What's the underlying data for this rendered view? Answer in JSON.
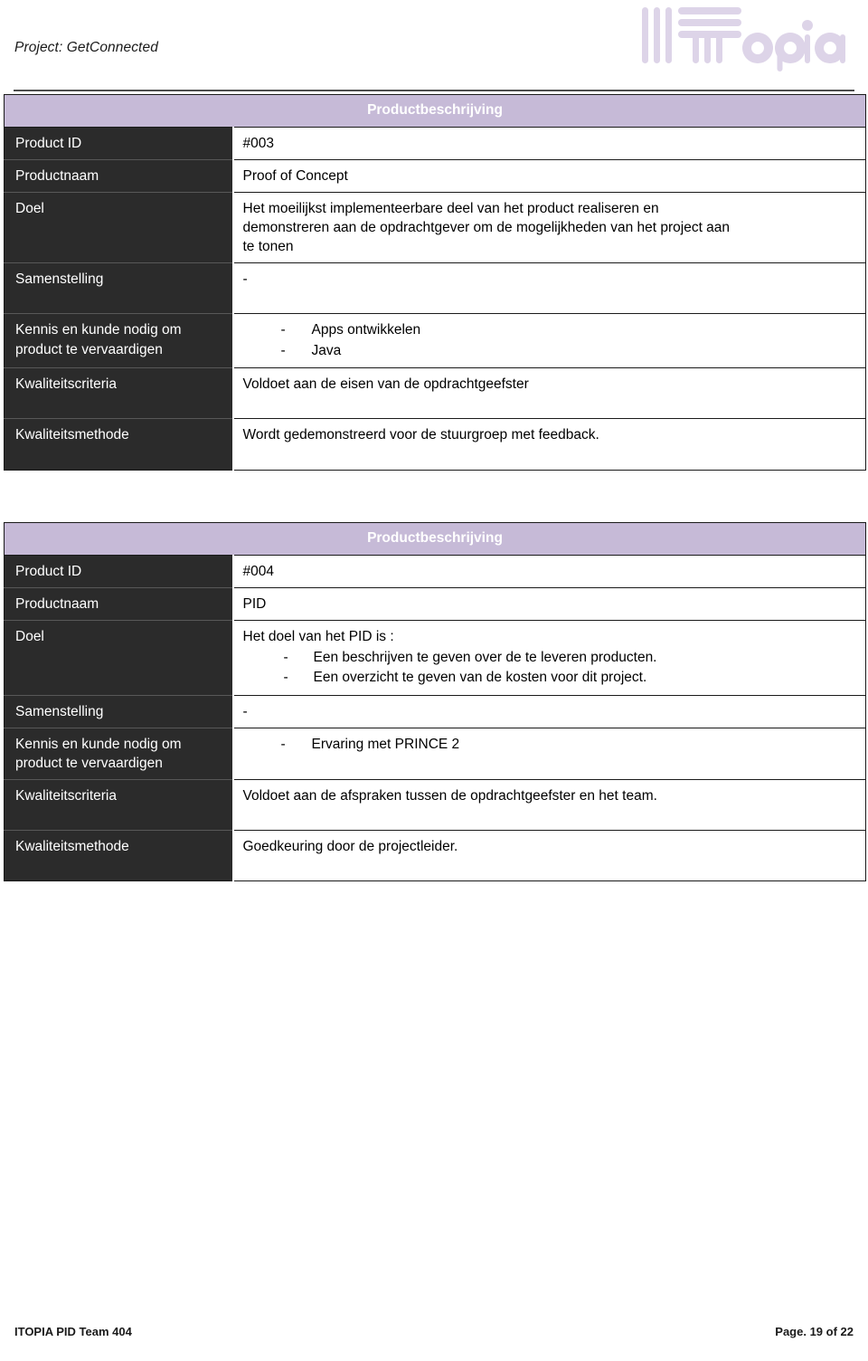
{
  "header": {
    "project_label": "Project: GetConnected",
    "logo_text": "ITOPIA",
    "logo_color": "#ddd4e8"
  },
  "theme": {
    "caption_bg": "#c6bad7",
    "label_bg": "#2b2b2b",
    "label_fg": "#ffffff",
    "value_bg": "#ffffff",
    "rule_color": "#4d4d4d"
  },
  "tables": [
    {
      "caption": "Productbeschrijving",
      "rows": [
        {
          "label": "Product ID",
          "value_lines": [
            "#003"
          ]
        },
        {
          "label": "Productnaam",
          "value_lines": [
            "Proof of Concept"
          ]
        },
        {
          "label": "Doel",
          "value_lines": [
            "Het moeilijkst implementeerbare deel van het product realiseren en",
            "demonstreren aan de opdrachtgever om de mogelijkheden van het project aan",
            "te tonen"
          ]
        },
        {
          "label": "Samenstelling",
          "value_lines": [
            "-"
          ]
        },
        {
          "label_lines": [
            "Kennis en kunde nodig om",
            "product te vervaardigen"
          ],
          "label": "Kennis en kunde nodig om product te vervaardigen",
          "bullets": [
            "Apps ontwikkelen",
            "Java"
          ]
        },
        {
          "label": "Kwaliteitscriteria",
          "value_lines": [
            "Voldoet aan de eisen van de opdrachtgeefster"
          ]
        },
        {
          "label": "Kwaliteitsmethode",
          "value_lines": [
            "Wordt gedemonstreerd voor de stuurgroep met feedback."
          ]
        }
      ]
    },
    {
      "caption": "Productbeschrijving",
      "rows": [
        {
          "label": "Product ID",
          "value_lines": [
            "#004"
          ]
        },
        {
          "label": "Productnaam",
          "value_lines": [
            "PID"
          ]
        },
        {
          "label": "Doel",
          "value_lines": [
            "Het doel van het PID is :"
          ],
          "bullets": [
            "Een beschrijven te geven over de te leveren producten.",
            "Een overzicht te geven van de kosten voor dit project."
          ]
        },
        {
          "label": "Samenstelling",
          "value_lines": [
            "-"
          ]
        },
        {
          "label_lines": [
            "Kennis en kunde nodig om",
            "product te vervaardigen"
          ],
          "label": "Kennis en kunde nodig om product te vervaardigen",
          "bullets": [
            "Ervaring met PRINCE 2"
          ]
        },
        {
          "label": "Kwaliteitscriteria",
          "value_lines": [
            "Voldoet aan de afspraken tussen de opdrachtgeefster en het team."
          ]
        },
        {
          "label": "Kwaliteitsmethode",
          "value_lines": [
            "Goedkeuring door de projectleider."
          ]
        }
      ]
    }
  ],
  "footer": {
    "left": "ITOPIA PID Team 404",
    "right": "Page. 19 of 22"
  }
}
